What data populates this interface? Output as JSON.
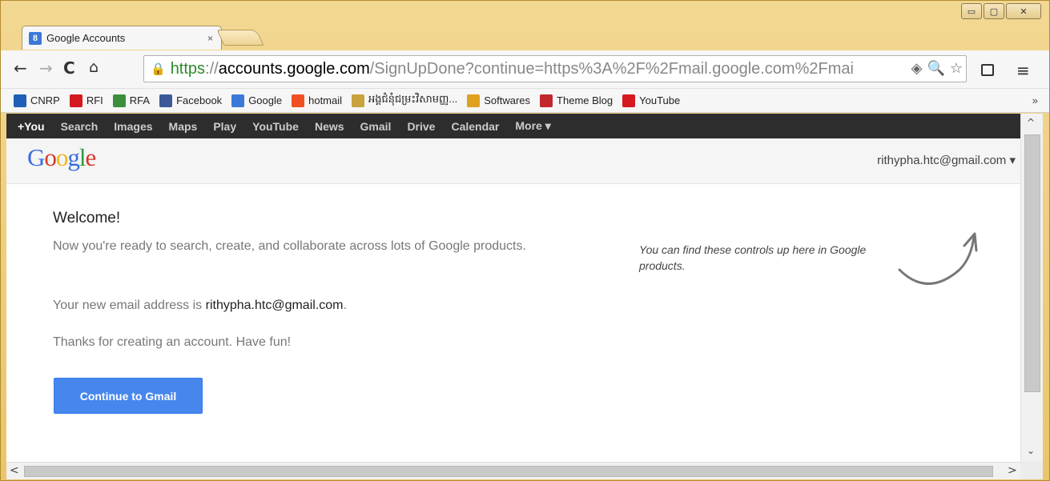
{
  "window": {
    "controls": {
      "minimize": "▭",
      "maximize": "▢",
      "close": "✕"
    }
  },
  "tab": {
    "title": "Google Accounts",
    "favicon": "8",
    "close": "×"
  },
  "toolbar": {
    "back": "←",
    "forward": "→",
    "reload": "C",
    "home": "⌂",
    "url_scheme": "https",
    "url_sep": "://",
    "url_host": "accounts.google.com",
    "url_path": "/SignUpDone?continue=https%3A%2F%2Fmail.google.com%2Fmai",
    "lock": "🔒",
    "icons": {
      "page_action": "◈",
      "zoom": "🔍",
      "star": "☆"
    },
    "menu": "≡"
  },
  "bookmarks": {
    "items": [
      {
        "label": "CNRP",
        "icon": "cnrp-icon",
        "color": "#1f5fb5"
      },
      {
        "label": "RFI",
        "icon": "rfi-icon",
        "color": "#d4191f"
      },
      {
        "label": "RFA",
        "icon": "rfa-icon",
        "color": "#3b8f3b"
      },
      {
        "label": "Facebook",
        "icon": "facebook-icon",
        "color": "#3b5998"
      },
      {
        "label": "Google",
        "icon": "google-icon",
        "color": "#3b79d8"
      },
      {
        "label": "hotmail",
        "icon": "windows-icon",
        "color": "#f25022"
      },
      {
        "label": "អង្គជំនុំជម្រះវិសាមញ្ញ...",
        "icon": "eccc-icon",
        "color": "#c8a23a"
      },
      {
        "label": "Softwares",
        "icon": "softwares-icon",
        "color": "#e0a020"
      },
      {
        "label": "Theme Blog",
        "icon": "theme-blog-icon",
        "color": "#c0282d"
      },
      {
        "label": "YouTube",
        "icon": "youtube-icon",
        "color": "#d4191f"
      }
    ],
    "more": "»"
  },
  "gbar": {
    "items": [
      "+You",
      "Search",
      "Images",
      "Maps",
      "Play",
      "YouTube",
      "News",
      "Gmail",
      "Drive",
      "Calendar",
      "More ▾"
    ]
  },
  "header": {
    "logo": [
      "G",
      "o",
      "o",
      "g",
      "l",
      "e"
    ],
    "account": "rithypha.htc@gmail.com ▾"
  },
  "main": {
    "welcome": "Welcome!",
    "line1": "Now you're ready to search, create, and collaborate across lots of Google products.",
    "line2_prefix": "Your new email address is ",
    "email": "rithypha.htc@gmail.com",
    "line2_suffix": ".",
    "line3": "Thanks for creating an account. Have fun!",
    "cta": "Continue to Gmail",
    "hint": "You can find these controls up here in Google products."
  },
  "scroll": {
    "up": "^",
    "down": "⌄",
    "left": "<",
    "right": ">"
  }
}
